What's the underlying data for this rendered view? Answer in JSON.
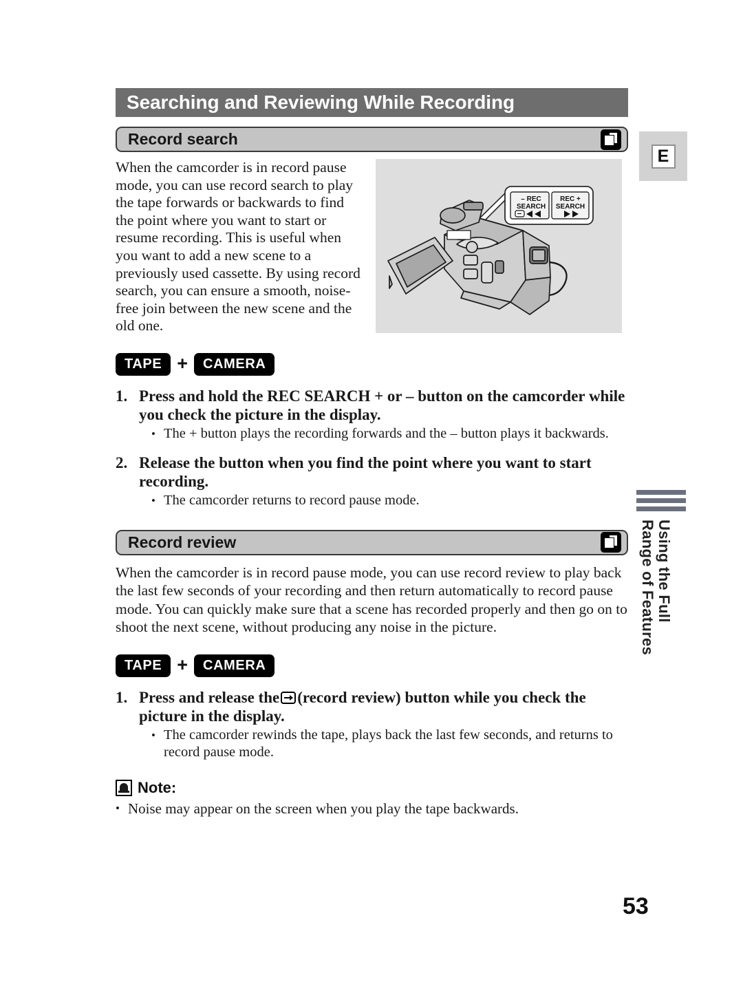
{
  "page": {
    "title": "Searching and Reviewing While Recording",
    "page_number": "53",
    "language_tab": "E",
    "side_tab_line1": "Using the Full",
    "side_tab_line2": "Range of Features"
  },
  "record_search": {
    "heading": "Record search",
    "icon": "cassette-icon",
    "intro": "When the camcorder is in record pause mode, you can use record search to play the tape forwards or backwards to find the point where you want to start or resume recording. This is useful when you want to add a new scene to a previously used cassette. By using record search, you can ensure a smooth, noise-free join between the new scene and the old one.",
    "badges": {
      "first": "TAPE",
      "plus": "+",
      "second": "CAMERA"
    },
    "figure": {
      "callout_left_top": "–  REC",
      "callout_left_mid": "SEARCH",
      "callout_right_top": "REC +",
      "callout_right_mid": "SEARCH"
    },
    "steps": [
      {
        "number": "1.",
        "title": "Press and hold the REC SEARCH + or – button on the camcorder while you check the picture in the display.",
        "bullets": [
          "The + button plays the recording forwards and the – button plays it backwards."
        ]
      },
      {
        "number": "2.",
        "title": "Release the button when you find the point where you want to start recording.",
        "bullets": [
          "The camcorder returns to record pause mode."
        ]
      }
    ]
  },
  "record_review": {
    "heading": "Record review",
    "icon": "cassette-icon",
    "intro": "When the camcorder is in record pause mode, you can use record review to play back the last few seconds of your recording and then return automatically to record pause mode. You can quickly make sure that a scene has recorded properly and then go on to shoot the next scene, without producing any noise in the picture.",
    "badges": {
      "first": "TAPE",
      "plus": "+",
      "second": "CAMERA"
    },
    "steps": [
      {
        "number": "1.",
        "title_before_icon": "Press and release the",
        "inline_icon": "record-review-icon",
        "title_after_icon": "(record review) button while you check the picture in the display.",
        "bullets": [
          "The camcorder rewinds the tape, plays back the last few seconds, and returns to record pause mode."
        ]
      }
    ]
  },
  "note": {
    "icon": "note-icon",
    "label": "Note:",
    "bullet_dot": "•",
    "items": [
      "Noise may appear on the screen when you play the tape backwards."
    ]
  },
  "bullet_dot": "•",
  "colors": {
    "title_bar": "#6e6e6e",
    "section_bar": "#c4c4c4",
    "figure_bg": "#dedede",
    "badge_bg": "#000000",
    "side_rule": "#6b7080"
  }
}
